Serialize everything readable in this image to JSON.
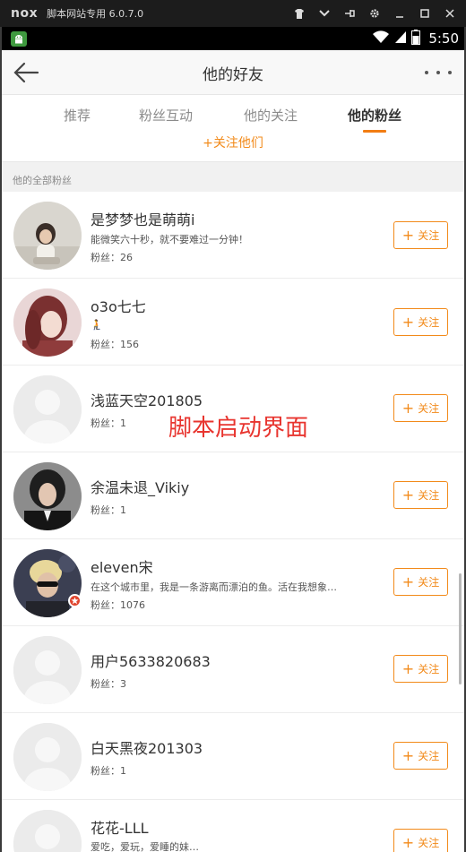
{
  "emulator": {
    "logo": "nox",
    "title": "脚本网站专用 6.0.7.0",
    "controls": [
      "shirt-icon",
      "chevron-down-icon",
      "pin-icon",
      "gear-icon",
      "minimize-icon",
      "maximize-icon",
      "close-icon"
    ]
  },
  "status_bar": {
    "app_icon": "android-robot-icon",
    "time": "5:50"
  },
  "header": {
    "title": "他的好友",
    "back_icon": "back-arrow-icon",
    "more_icon": "more-dots-icon"
  },
  "tabs": [
    {
      "label": "推荐",
      "active": false
    },
    {
      "label": "粉丝互动",
      "active": false
    },
    {
      "label": "他的关注",
      "active": false
    },
    {
      "label": "他的粉丝",
      "active": true
    }
  ],
  "follow_all_label": "+关注他们",
  "section_label": "他的全部粉丝",
  "follow_button_label": "关注",
  "users": [
    {
      "name": "是梦梦也是萌萌i",
      "bio": "能微笑六十秒，就不要难过一分钟！",
      "fans": "粉丝：26"
    },
    {
      "name": "o3o七七",
      "bio": "🧎",
      "fans": "粉丝：156"
    },
    {
      "name": "浅蓝天空201805",
      "bio": "",
      "fans": "粉丝：1"
    },
    {
      "name": "余温未退_Vikiy",
      "bio": "",
      "fans": "粉丝：1"
    },
    {
      "name": "eleven宋",
      "bio": "在这个城市里，我是一条游离而漂泊的鱼。活在我想象…",
      "fans": "粉丝：1076",
      "verified": true
    },
    {
      "name": "用户5633820683",
      "bio": "",
      "fans": "粉丝：3"
    },
    {
      "name": "白天黑夜201303",
      "bio": "",
      "fans": "粉丝：1"
    },
    {
      "name": "花花-LLL",
      "bio": "爱吃，爱玩，爱睡的妹…",
      "fans": ""
    }
  ],
  "overlay_text": "脚本启动界面",
  "colors": {
    "accent": "#f28a1a",
    "tab_indicator": "#f27d13",
    "overlay": "#e8352f",
    "verified_badge": "#e0452f"
  }
}
